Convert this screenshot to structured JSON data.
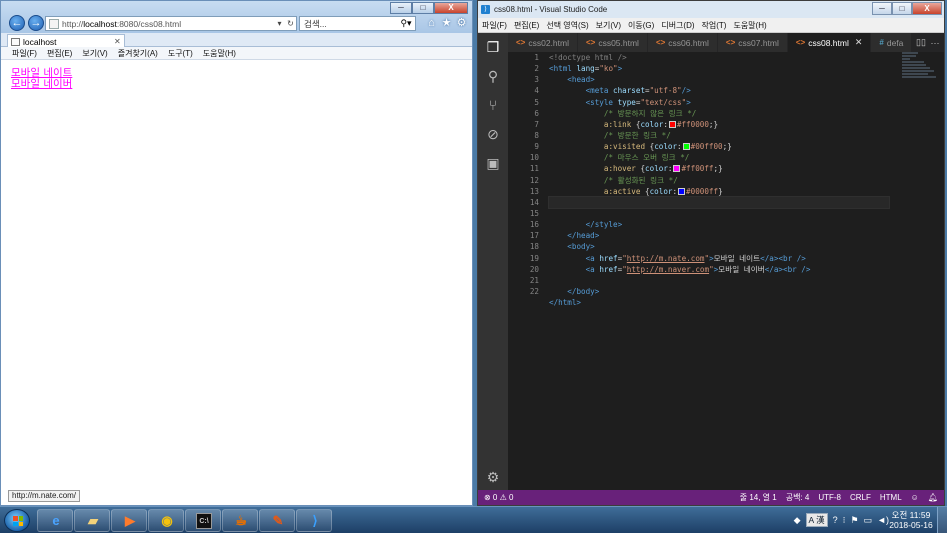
{
  "ie": {
    "address": {
      "prefix": "http://",
      "host": "localhost",
      "rest": ":8080/css08.html"
    },
    "search_placeholder": "검색...",
    "tab_label": "localhost",
    "menu": [
      "파일(F)",
      "편집(E)",
      "보기(V)",
      "즐겨찾기(A)",
      "도구(T)",
      "도움말(H)"
    ],
    "links": [
      {
        "text": "모바일 네이트",
        "color": "#ff00ff"
      },
      {
        "text": "모바일 네이버",
        "color": "#ff00ff"
      }
    ],
    "status_url": "http://m.nate.com/",
    "window_controls": [
      "─",
      "□",
      "X"
    ]
  },
  "vscode": {
    "title": "css08.html - Visual Studio Code",
    "menu": [
      "파일(F)",
      "편집(E)",
      "선택 영역(S)",
      "보기(V)",
      "이동(G)",
      "디버그(D)",
      "작업(T)",
      "도움말(H)"
    ],
    "tabs": [
      {
        "label": "css02.html",
        "active": false
      },
      {
        "label": "css05.html",
        "active": false
      },
      {
        "label": "css06.html",
        "active": false
      },
      {
        "label": "css07.html",
        "active": false
      },
      {
        "label": "css08.html",
        "active": true
      },
      {
        "label": "defa",
        "active": false
      }
    ],
    "activity_icons": [
      "explorer-icon",
      "search-icon",
      "source-control-icon",
      "debug-icon",
      "extensions-icon",
      "settings-gear-icon"
    ],
    "line_numbers": [
      "1",
      "2",
      "3",
      "4",
      "5",
      "6",
      "7",
      "8",
      "9",
      "10",
      "11",
      "12",
      "13",
      "14",
      "15",
      "16",
      "17",
      "18",
      "19",
      "20",
      "21",
      "22"
    ],
    "current_line": 14,
    "code": {
      "l1": "<!doctype html />",
      "l2_tag": "<html",
      "l2_attr": "lang",
      "l2_val": "\"ko\"",
      "l3": "<head>",
      "l4_tag": "<meta",
      "l4_attr": "charset",
      "l4_val": "\"utf-8\"",
      "l5_tag": "<style",
      "l5_attr": "type",
      "l5_val": "\"text/css\"",
      "l6": "/* 방문하지 않은 링크 */",
      "l7_sel": "a:link",
      "l7_prop": "color",
      "l7_val": "#ff0000",
      "l8": "/* 방문한 링크 */",
      "l9_sel": "a:visited",
      "l9_prop": "color",
      "l9_val": "#00ff00",
      "l10": "/* 마우스 오버 링크 */",
      "l11_sel": "a:hover",
      "l11_prop": "color",
      "l11_val": "#ff00ff",
      "l12": "/* 활성화된 링크 */",
      "l13_sel": "a:active",
      "l13_prop": "color",
      "l13_val": "#0000ff",
      "l16": "</style>",
      "l17": "</head>",
      "l18": "<body>",
      "l19_attr": "href",
      "l19_url": "http://m.nate.com",
      "l19_text": "모바일 네이트",
      "l20_attr": "href",
      "l20_url": "http://m.naver.com",
      "l20_text": "모바일 네이버",
      "l22": "</body>",
      "l23": "</html>"
    },
    "swatch_colors": [
      "#ff0000",
      "#00ff00",
      "#ff00ff",
      "#0000ff"
    ],
    "status": {
      "problems": "⊗ 0 ⚠ 0",
      "position": "줄 14, 열 1",
      "spaces": "공백: 4",
      "encoding": "UTF-8",
      "eol": "CRLF",
      "language": "HTML"
    },
    "window_controls": [
      "─",
      "□",
      "X"
    ]
  },
  "taskbar": {
    "apps": [
      "ie-icon",
      "explorer-icon",
      "media-player-icon",
      "chrome-icon",
      "cmd-icon",
      "java-icon",
      "editor-icon",
      "vscode-icon"
    ],
    "ime": "A 漢",
    "time": "오전 11:59",
    "date": "2018-05-16"
  }
}
